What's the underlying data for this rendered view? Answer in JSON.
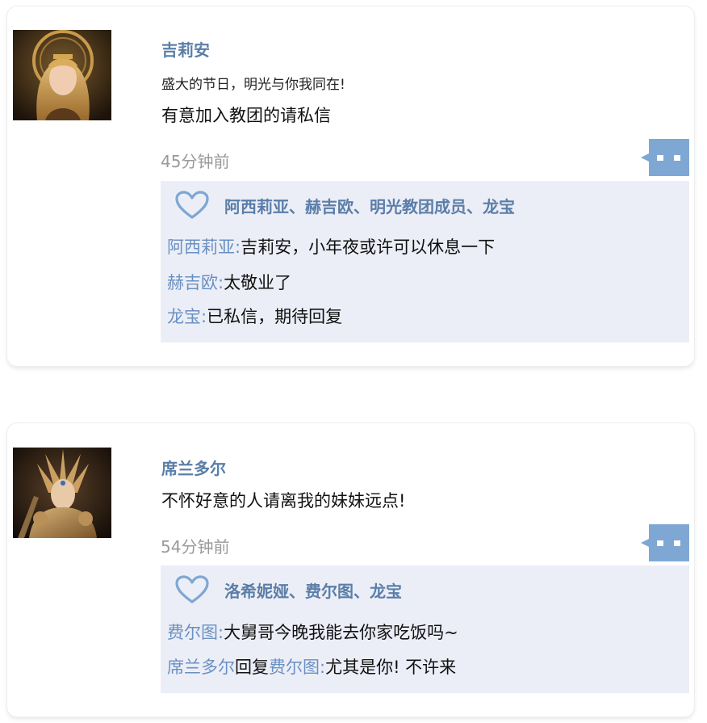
{
  "posts": [
    {
      "author": "吉莉安",
      "subtitle": "盛大的节日，明光与你我同在!",
      "text": "有意加入教团的请私信",
      "time": "45分钟前",
      "likers": "阿西莉亚、赫吉欧、明光教团成员、龙宝",
      "replies": [
        {
          "user": "阿西莉亚",
          "sep": ":",
          "text": "吉莉安，小年夜或许可以休息一下"
        },
        {
          "user": "赫吉欧",
          "sep": ":",
          "text": "太敬业了"
        },
        {
          "user": "龙宝",
          "sep": ":",
          "text": "已私信，期待回复"
        }
      ]
    },
    {
      "author": "席兰多尔",
      "text": "不怀好意的人请离我的妹妹远点!",
      "time": "54分钟前",
      "likers": "洛希妮娅、费尔图、龙宝",
      "replies": [
        {
          "user": "费尔图",
          "sep": ":",
          "text": "大舅哥今晚我能去你家吃饭吗~"
        },
        {
          "user": "席兰多尔",
          "reply_word": "回复",
          "reply_to": "费尔图",
          "sep": ":",
          "text": "尤其是你! 不许来"
        }
      ]
    }
  ],
  "colors": {
    "name": "#5b7ea8",
    "reply_user": "#6a90c2",
    "time": "#9a9a9a",
    "panel_bg": "#eceef7",
    "comment_icon": "#7fa7d3"
  },
  "icons": {
    "comment": "comment-bubble-icon",
    "like": "heart-icon"
  }
}
